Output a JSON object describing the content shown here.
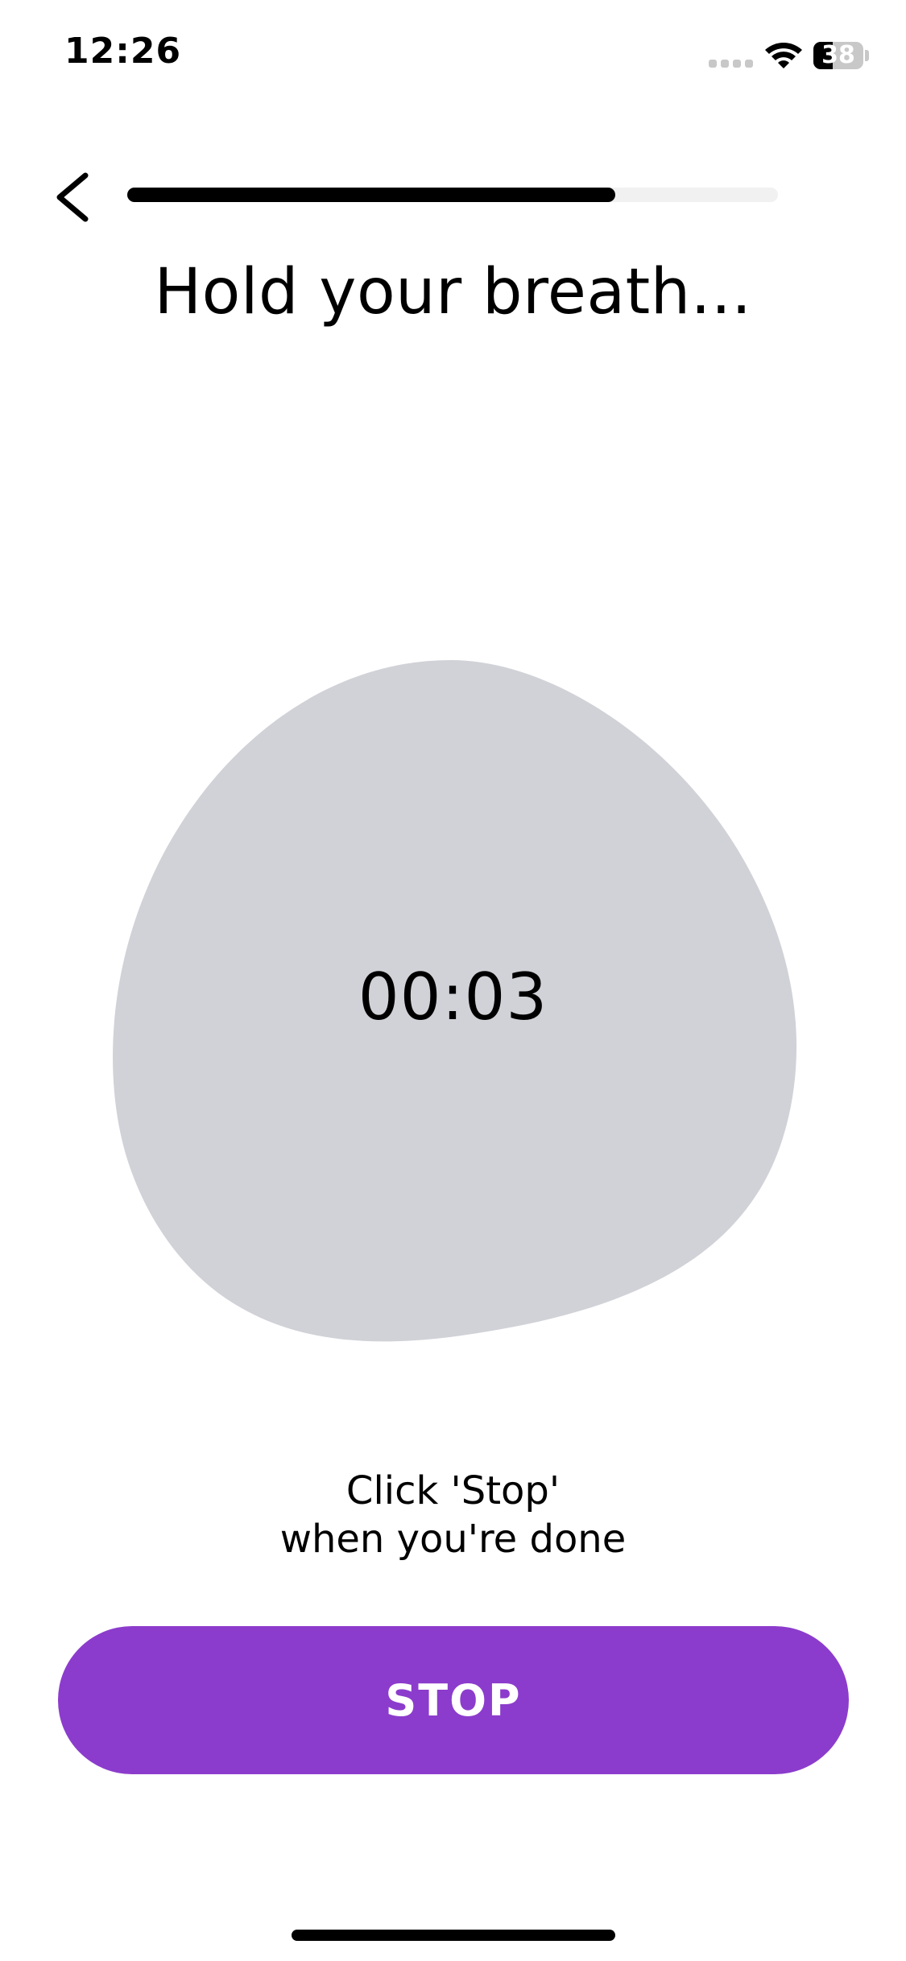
{
  "status_bar": {
    "time": "12:26",
    "battery_level": "38",
    "battery_fraction": 0.38,
    "signal_icon": "cellular-signal-icon",
    "wifi_icon": "wifi-icon",
    "battery_icon": "battery-icon"
  },
  "header": {
    "back_icon": "chevron-left-icon",
    "progress_fraction": 0.75
  },
  "main": {
    "title": "Hold your breath...",
    "timer": "00:03",
    "instruction_line1": "Click 'Stop'",
    "instruction_line2": "when you're done"
  },
  "stop_button": {
    "label": "STOP"
  },
  "colors": {
    "accent": "#8c3ccc",
    "blob": "#d1d2d7",
    "progress_track": "#f1f1f1",
    "progress_fill": "#000000"
  }
}
